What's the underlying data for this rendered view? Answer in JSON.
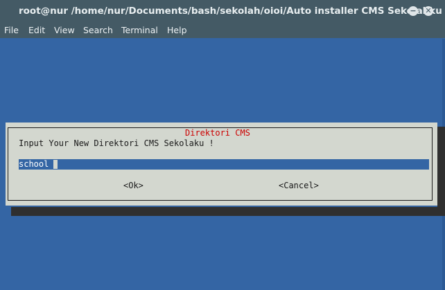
{
  "window": {
    "title": "root@nur /home/nur/Documents/bash/sekolah/oioi/Auto installer CMS Sekolahku",
    "minimize_glyph": "−",
    "close_glyph": "✕"
  },
  "menu": {
    "items": [
      {
        "label": "File"
      },
      {
        "label": "Edit"
      },
      {
        "label": "View"
      },
      {
        "label": "Search"
      },
      {
        "label": "Terminal"
      },
      {
        "label": "Help"
      }
    ]
  },
  "dialog": {
    "title": "Direktori CMS",
    "prompt": "Input Your New Direktori CMS Sekolaku !",
    "input_value": "school",
    "ok_label": "<Ok>",
    "cancel_label": "<Cancel>"
  },
  "colors": {
    "terminal_bg": "#3465a4",
    "titlebar_bg": "#445a65",
    "dialog_bg": "#d3d7cf",
    "dialog_title": "#cc0000"
  }
}
